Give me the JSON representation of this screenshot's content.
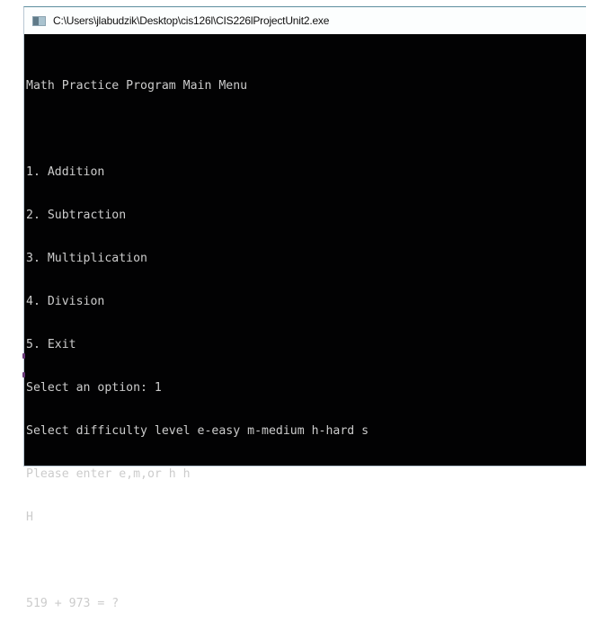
{
  "window": {
    "title": "C:\\Users\\jlabudzik\\Desktop\\cis126l\\CIS226lProjectUnit2.exe",
    "icon": "console-app-icon"
  },
  "console": {
    "lines": [
      "Math Practice Program Main Menu",
      "",
      "1. Addition",
      "2. Subtraction",
      "3. Multiplication",
      "4. Division",
      "5. Exit",
      "Select an option: 1",
      "Select difficulty level e-easy m-medium h-hard s",
      "Please enter e,m,or h h",
      "H",
      "",
      "519 + 973 = ?"
    ]
  },
  "colors": {
    "console_background": "#020203",
    "console_text": "#cccccc",
    "titlebar_background": "#fcfefe"
  }
}
